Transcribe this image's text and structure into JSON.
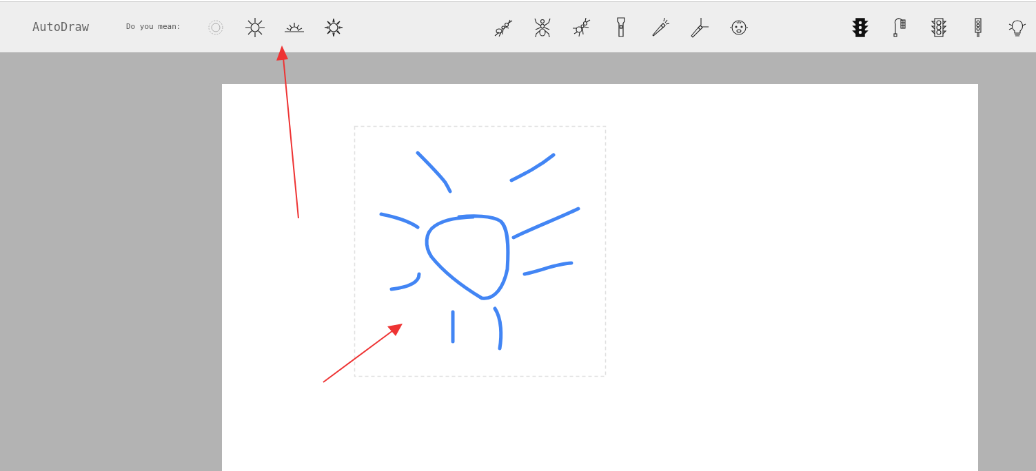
{
  "app": {
    "title": "AutoDraw"
  },
  "suggestions": {
    "label": "Do you mean:"
  }
}
